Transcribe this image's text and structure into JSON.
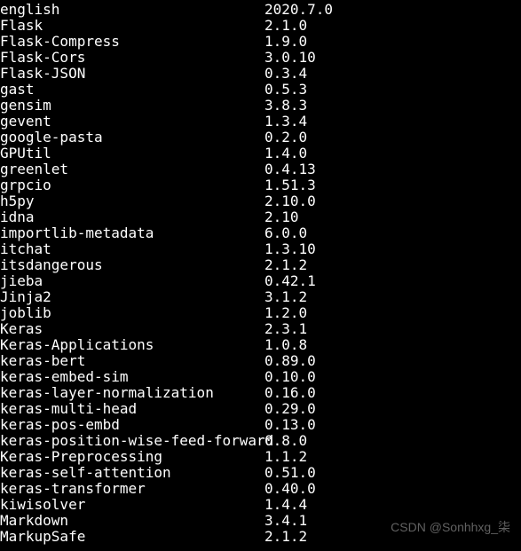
{
  "packages": [
    {
      "name": "english",
      "version": "2020.7.0"
    },
    {
      "name": "Flask",
      "version": "2.1.0"
    },
    {
      "name": "Flask-Compress",
      "version": "1.9.0"
    },
    {
      "name": "Flask-Cors",
      "version": "3.0.10"
    },
    {
      "name": "Flask-JSON",
      "version": "0.3.4"
    },
    {
      "name": "gast",
      "version": "0.5.3"
    },
    {
      "name": "gensim",
      "version": "3.8.3"
    },
    {
      "name": "gevent",
      "version": "1.3.4"
    },
    {
      "name": "google-pasta",
      "version": "0.2.0"
    },
    {
      "name": "GPUtil",
      "version": "1.4.0"
    },
    {
      "name": "greenlet",
      "version": "0.4.13"
    },
    {
      "name": "grpcio",
      "version": "1.51.3"
    },
    {
      "name": "h5py",
      "version": "2.10.0"
    },
    {
      "name": "idna",
      "version": "2.10"
    },
    {
      "name": "importlib-metadata",
      "version": "6.0.0"
    },
    {
      "name": "itchat",
      "version": "1.3.10"
    },
    {
      "name": "itsdangerous",
      "version": "2.1.2"
    },
    {
      "name": "jieba",
      "version": "0.42.1"
    },
    {
      "name": "Jinja2",
      "version": "3.1.2"
    },
    {
      "name": "joblib",
      "version": "1.2.0"
    },
    {
      "name": "Keras",
      "version": "2.3.1"
    },
    {
      "name": "Keras-Applications",
      "version": "1.0.8"
    },
    {
      "name": "keras-bert",
      "version": "0.89.0"
    },
    {
      "name": "keras-embed-sim",
      "version": "0.10.0"
    },
    {
      "name": "keras-layer-normalization",
      "version": "0.16.0"
    },
    {
      "name": "keras-multi-head",
      "version": "0.29.0"
    },
    {
      "name": "keras-pos-embd",
      "version": "0.13.0"
    },
    {
      "name": "keras-position-wise-feed-forward",
      "version": "0.8.0"
    },
    {
      "name": "Keras-Preprocessing",
      "version": "1.1.2"
    },
    {
      "name": "keras-self-attention",
      "version": "0.51.0"
    },
    {
      "name": "keras-transformer",
      "version": "0.40.0"
    },
    {
      "name": "kiwisolver",
      "version": "1.4.4"
    },
    {
      "name": "Markdown",
      "version": "3.4.1"
    },
    {
      "name": "MarkupSafe",
      "version": "2.1.2"
    }
  ],
  "watermark": "CSDN @Sonhhxg_柒"
}
